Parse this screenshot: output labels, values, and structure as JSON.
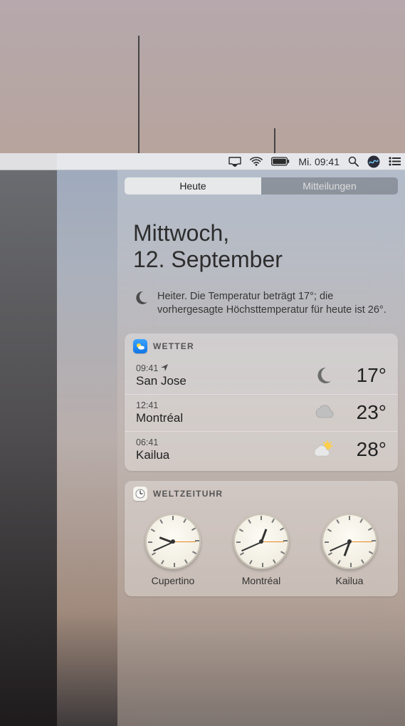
{
  "menubar": {
    "clock": "Mi. 09:41"
  },
  "callouts": {},
  "tabs": {
    "today": "Heute",
    "notifications": "Mitteilungen"
  },
  "date": {
    "line1": "Mittwoch,",
    "line2": "12. September"
  },
  "summary": {
    "text": "Heiter. Die Temperatur beträgt 17°; die vorhergesagte Höchsttemperatur für heute ist 26°."
  },
  "weather": {
    "title": "WETTER",
    "rows": [
      {
        "time": "09:41",
        "city": "San Jose",
        "icon": "moon",
        "temp": "17°",
        "is_current_location": true
      },
      {
        "time": "12:41",
        "city": "Montréal",
        "icon": "cloud",
        "temp": "23°",
        "is_current_location": false
      },
      {
        "time": "06:41",
        "city": "Kailua",
        "icon": "suncloud",
        "temp": "28°",
        "is_current_location": false
      }
    ]
  },
  "worldclock": {
    "title": "WELTZEITUHR",
    "clocks": [
      {
        "city": "Cupertino",
        "h": 9,
        "m": 41,
        "s": 15
      },
      {
        "city": "Montréal",
        "h": 12,
        "m": 41,
        "s": 15
      },
      {
        "city": "Kailua",
        "h": 6,
        "m": 41,
        "s": 15
      }
    ]
  }
}
